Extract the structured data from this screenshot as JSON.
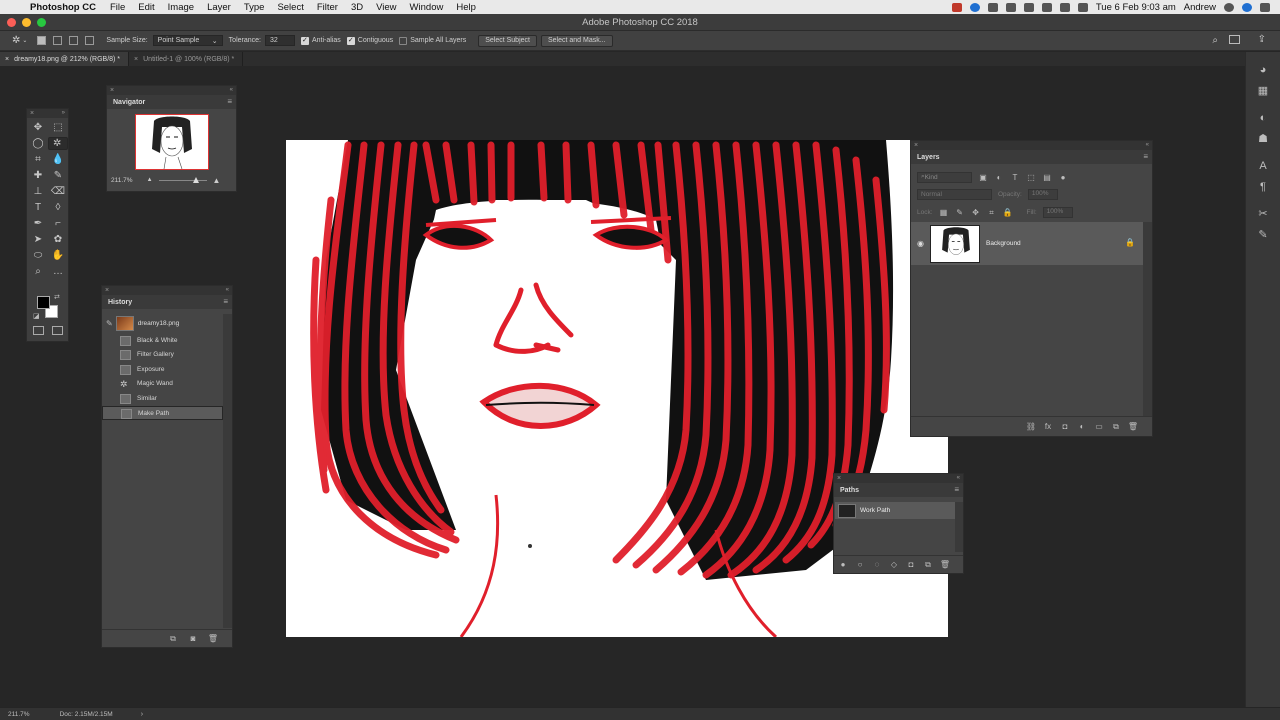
{
  "menubar": {
    "app_name": "Photoshop CC",
    "items": [
      "File",
      "Edit",
      "Image",
      "Layer",
      "Type",
      "Select",
      "Filter",
      "3D",
      "View",
      "Window",
      "Help"
    ],
    "clock": "Tue 6 Feb  9:03 am",
    "user": "Andrew"
  },
  "window": {
    "title": "Adobe Photoshop CC 2018"
  },
  "options": {
    "sample_size_label": "Sample Size:",
    "sample_size_value": "Point Sample",
    "tolerance_label": "Tolerance:",
    "tolerance_value": "32",
    "anti_alias": "Anti-alias",
    "contiguous": "Contiguous",
    "sample_all_layers": "Sample All Layers",
    "select_subject": "Select Subject",
    "select_and_mask": "Select and Mask..."
  },
  "tabs": [
    {
      "label": "dreamy18.png @ 212% (RGB/8) *",
      "close": "×"
    },
    {
      "label": "Untitled-1 @ 100% (RGB/8) *",
      "close": "×"
    }
  ],
  "navigator": {
    "title": "Navigator",
    "zoom": "211.7%"
  },
  "history": {
    "title": "History",
    "snapshot": "dreamy18.png",
    "states": [
      "Black & White",
      "Filter Gallery",
      "Exposure",
      "Magic Wand",
      "Similar",
      "Make Path"
    ],
    "selected_state": "Make Path"
  },
  "layers": {
    "title": "Layers",
    "kind_placeholder": "Kind",
    "blend_mode": "Normal",
    "opacity_label": "Opacity:",
    "opacity_value": "100%",
    "lock_label": "Lock:",
    "fill_label": "Fill:",
    "fill_value": "100%",
    "layer_name": "Background"
  },
  "paths": {
    "title": "Paths",
    "path_name": "Work Path"
  },
  "status": {
    "zoom": "211.7%",
    "doc": "Doc: 2.15M/2.15M"
  },
  "colors": {
    "path_red": "#e01f2b",
    "foreground": "#000000",
    "background": "#ffffff"
  }
}
